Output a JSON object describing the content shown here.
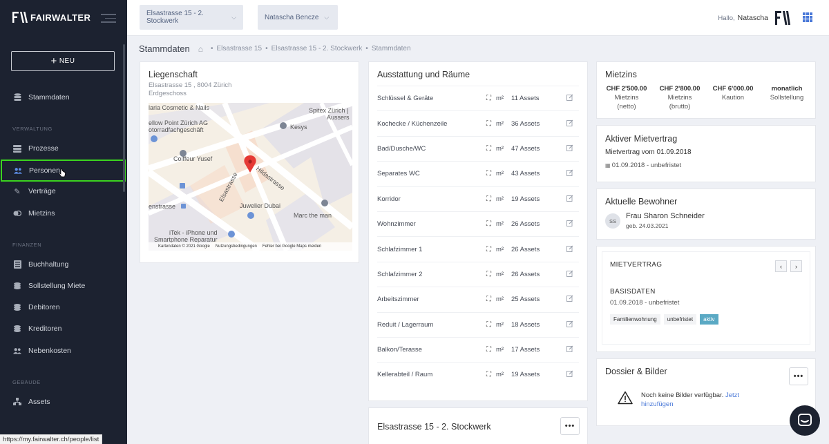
{
  "sidebar": {
    "logo": "FAIRWALTER",
    "new_button": "NEU",
    "nav_top": [
      {
        "label": "Stammdaten",
        "icon": "database-icon"
      }
    ],
    "section_verwaltung": "VERWALTUNG",
    "nav_verwaltung": [
      {
        "label": "Prozesse",
        "icon": "layers-icon"
      },
      {
        "label": "Personen",
        "icon": "people-icon",
        "active": true
      },
      {
        "label": "Verträge",
        "icon": "pencil-icon"
      },
      {
        "label": "Mietzins",
        "icon": "coins-icon"
      }
    ],
    "section_finanzen": "FINANZEN",
    "nav_finanzen": [
      {
        "label": "Buchhaltung",
        "icon": "ledger-icon"
      },
      {
        "label": "Sollstellung Miete",
        "icon": "coins-icon"
      },
      {
        "label": "Debitoren",
        "icon": "coins-icon"
      },
      {
        "label": "Kreditoren",
        "icon": "coins-icon"
      },
      {
        "label": "Nebenkosten",
        "icon": "people-icon"
      }
    ],
    "section_gebaeude": "GEBÄUDE",
    "nav_gebaeude": [
      {
        "label": "Assets",
        "icon": "assets-icon"
      }
    ]
  },
  "status_url": "https://my.fairwalter.ch/people/list",
  "topbar": {
    "property_dropdown": "Elsastrasse 15 - 2. Stockwerk",
    "person_dropdown": "Natascha Bencze",
    "hello": "Hallo,",
    "user": "Natascha"
  },
  "breadcrumb": {
    "page_title": "Stammdaten",
    "items": [
      "Elsastrasse 15",
      "Elsastrasse 15 - 2. Stockwerk",
      "Stammdaten"
    ]
  },
  "liegenschaft": {
    "title": "Liegenschaft",
    "address": "Elsastrasse 15 , 8004 Zürich",
    "floor": "Erdgeschoss",
    "map_labels": {
      "l1": "laria Cosmetic & Nails",
      "l2": "Spitex Zürich |",
      "l3": "Aussers",
      "l4": "ellow Point Zürich AG",
      "l5": "otorradfachgeschäft",
      "l6": "Kesys",
      "l7": "Coiffeur Yusef",
      "l8": "Hildastrasse",
      "l9": "Elsastrasse",
      "l10": "enstrasse",
      "l11": "Juwelier Dubai",
      "l12": "Marc the man",
      "l13": "iTek - iPhone und",
      "l14": "Smartphone Reparatur",
      "f1": "Kartendaten © 2021 Google",
      "f2": "Nutzungsbedingungen",
      "f3": "Fehler bei Google Maps melden"
    }
  },
  "ausstattung": {
    "title": "Ausstattung und Räume",
    "unit": "m²",
    "rows": [
      {
        "name": "Schlüssel & Geräte",
        "assets": "11 Assets"
      },
      {
        "name": "Kochecke / Küchenzeile",
        "assets": "36 Assets"
      },
      {
        "name": "Bad/Dusche/WC",
        "assets": "47 Assets"
      },
      {
        "name": "Separates WC",
        "assets": "43 Assets"
      },
      {
        "name": "Korridor",
        "assets": "19 Assets"
      },
      {
        "name": "Wohnzimmer",
        "assets": "26 Assets"
      },
      {
        "name": "Schlafzimmer 1",
        "assets": "26 Assets"
      },
      {
        "name": "Schlafzimmer 2",
        "assets": "26 Assets"
      },
      {
        "name": "Arbeitszimmer",
        "assets": "25 Assets"
      },
      {
        "name": "Reduit / Lagerraum",
        "assets": "18 Assets"
      },
      {
        "name": "Balkon/Terasse",
        "assets": "17 Assets"
      },
      {
        "name": "Kellerabteil / Raum",
        "assets": "19 Assets"
      }
    ]
  },
  "gebaeude_card": {
    "title": "Elsastrasse 15 - 2. Stockwerk"
  },
  "mietzins": {
    "title": "Mietzins",
    "items": [
      {
        "value": "CHF 2'500.00",
        "l1": "Mietzins",
        "l2": "(netto)"
      },
      {
        "value": "CHF 2'800.00",
        "l1": "Mietzins",
        "l2": "(brutto)"
      },
      {
        "value": "CHF 6'000.00",
        "l1": "Kaution",
        "l2": ""
      },
      {
        "value": "monatlich",
        "l1": "Sollstellung",
        "l2": ""
      }
    ]
  },
  "aktiver_mietvertrag": {
    "title": "Aktiver Mietvertrag",
    "line1": "Mietvertrag vom 01.09.2018",
    "line2": "01.09.2018 - unbefristet"
  },
  "bewohner": {
    "title": "Aktuelle Bewohner",
    "initials": "SS",
    "name": "Frau Sharon Schneider",
    "birth": "geb. 24.03.2021"
  },
  "mietvertrag": {
    "title": "MIETVERTRAG",
    "section": "BASISDATEN",
    "dates": "01.09.2018 - unbefristet",
    "tags": [
      "Familienwohnung",
      "unbefristet",
      "aktiv"
    ],
    "accent": "#5aa9c4"
  },
  "dossier": {
    "title": "Dossier & Bilder",
    "empty_text": "Noch keine Bilder verfügbar.",
    "link": "Jetzt hinzufügen"
  },
  "colors": {
    "sidebar_bg": "#1c2230",
    "highlight": "#3bd41f",
    "link": "#4a79d8"
  }
}
